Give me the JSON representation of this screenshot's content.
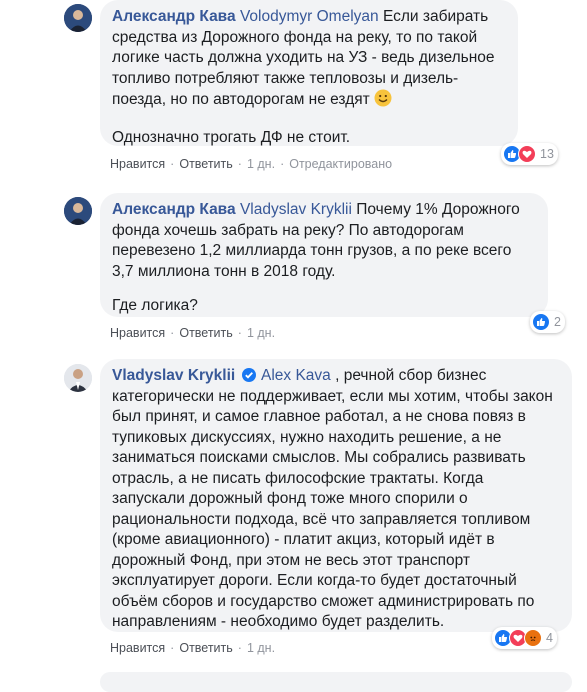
{
  "comments": [
    {
      "author": "Александр Кава",
      "mention": "Volodymyr Omelyan",
      "text": " Если забирать средства из Дорожного фонда на реку, то по такой логике часть должна уходить на УЗ - ведь дизельное топливо потребляют также тепловозы и дизель-поезда, но по автодорогам не ездят ",
      "emoji": "smile-emoji",
      "text2": "Однозначно трогать ДФ не стоит.",
      "actions": {
        "like": "Нравится",
        "reply": "Ответить",
        "time": "1 дн.",
        "edited": "Отредактировано"
      },
      "reactions": {
        "count": "13"
      }
    },
    {
      "author": "Александр Кава",
      "mention": "Vladyslav Kryklii",
      "text": " Почему 1% Дорожного фонда хочешь забрать на реку? По автодорогам перевезено 1,2 миллиарда тонн грузов, а по реке всего 3,7 миллиона тонн в 2018 году.",
      "text2": "Где логика?",
      "actions": {
        "like": "Нравится",
        "reply": "Ответить",
        "time": "1 дн."
      },
      "reactions": {
        "count": "2"
      }
    },
    {
      "author": "Vladyslav Kryklii",
      "mention": "Alex Kava",
      "text": " , речной сбор бизнес категорически не поддерживает, если мы хотим, чтобы закон был принят, и самое главное работал, а не снова повяз в тупиковых дискуссиях, нужно находить решение, а не заниматься поисками смыслов. Мы собрались развивать отрасль, а не писать философские трактаты. Когда запускали дорожный фонд тоже много спорили о рациональности подхода, всё что заправляется топливом (кроме авиационного) - платит акциз, который идёт в дорожный Фонд, при этом не весь этот транспорт эксплуатирует дороги. Если когда-то будет достаточный объём сборов и государство сможет администрировать по направлениям - необходимо будет разделить.",
      "actions": {
        "like": "Нравится",
        "reply": "Ответить",
        "time": "1 дн."
      },
      "reactions": {
        "count": "4"
      }
    }
  ],
  "icons": {
    "like": "like-icon",
    "love": "love-icon",
    "angry": "angry-icon",
    "verified": "verified-badge-icon"
  },
  "colors": {
    "link": "#385898",
    "bubble": "#f2f3f5",
    "like": "#1877f2",
    "love": "#f33e58",
    "angry": "#f4a640"
  }
}
